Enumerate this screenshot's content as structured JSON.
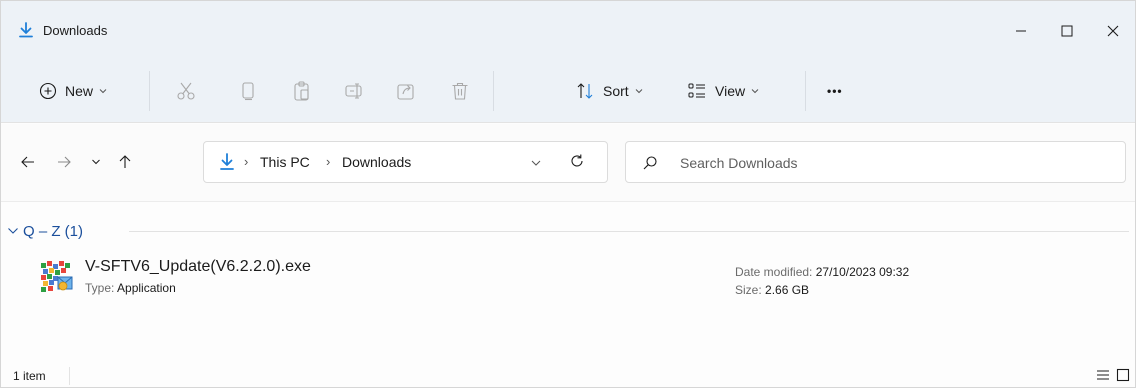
{
  "window": {
    "title": "Downloads",
    "controls": [
      "minimize",
      "maximize",
      "close"
    ]
  },
  "commandbar": {
    "new_label": "New",
    "sort_label": "Sort",
    "view_label": "View",
    "more_label": "•••",
    "icons": [
      "cut-icon",
      "copy-icon",
      "paste-icon",
      "rename-icon",
      "share-icon",
      "delete-icon"
    ]
  },
  "addressbar": {
    "crumbs": [
      "This PC",
      "Downloads"
    ],
    "separator": "›"
  },
  "search": {
    "placeholder": "Search Downloads"
  },
  "group": {
    "title": "Q – Z (1)"
  },
  "files": [
    {
      "name": "V-SFTV6_Update(V6.2.2.0).exe",
      "type_label": "Type:",
      "type_value": "Application",
      "date_label": "Date modified:",
      "date_value": "27/10/2023 09:32",
      "size_label": "Size:",
      "size_value": "2.66 GB"
    }
  ],
  "status": {
    "count": "1 item"
  },
  "colors": {
    "accent": "#1b4f9c",
    "download_green": "#2ea043",
    "chrome_bg": "#edf2f7"
  }
}
